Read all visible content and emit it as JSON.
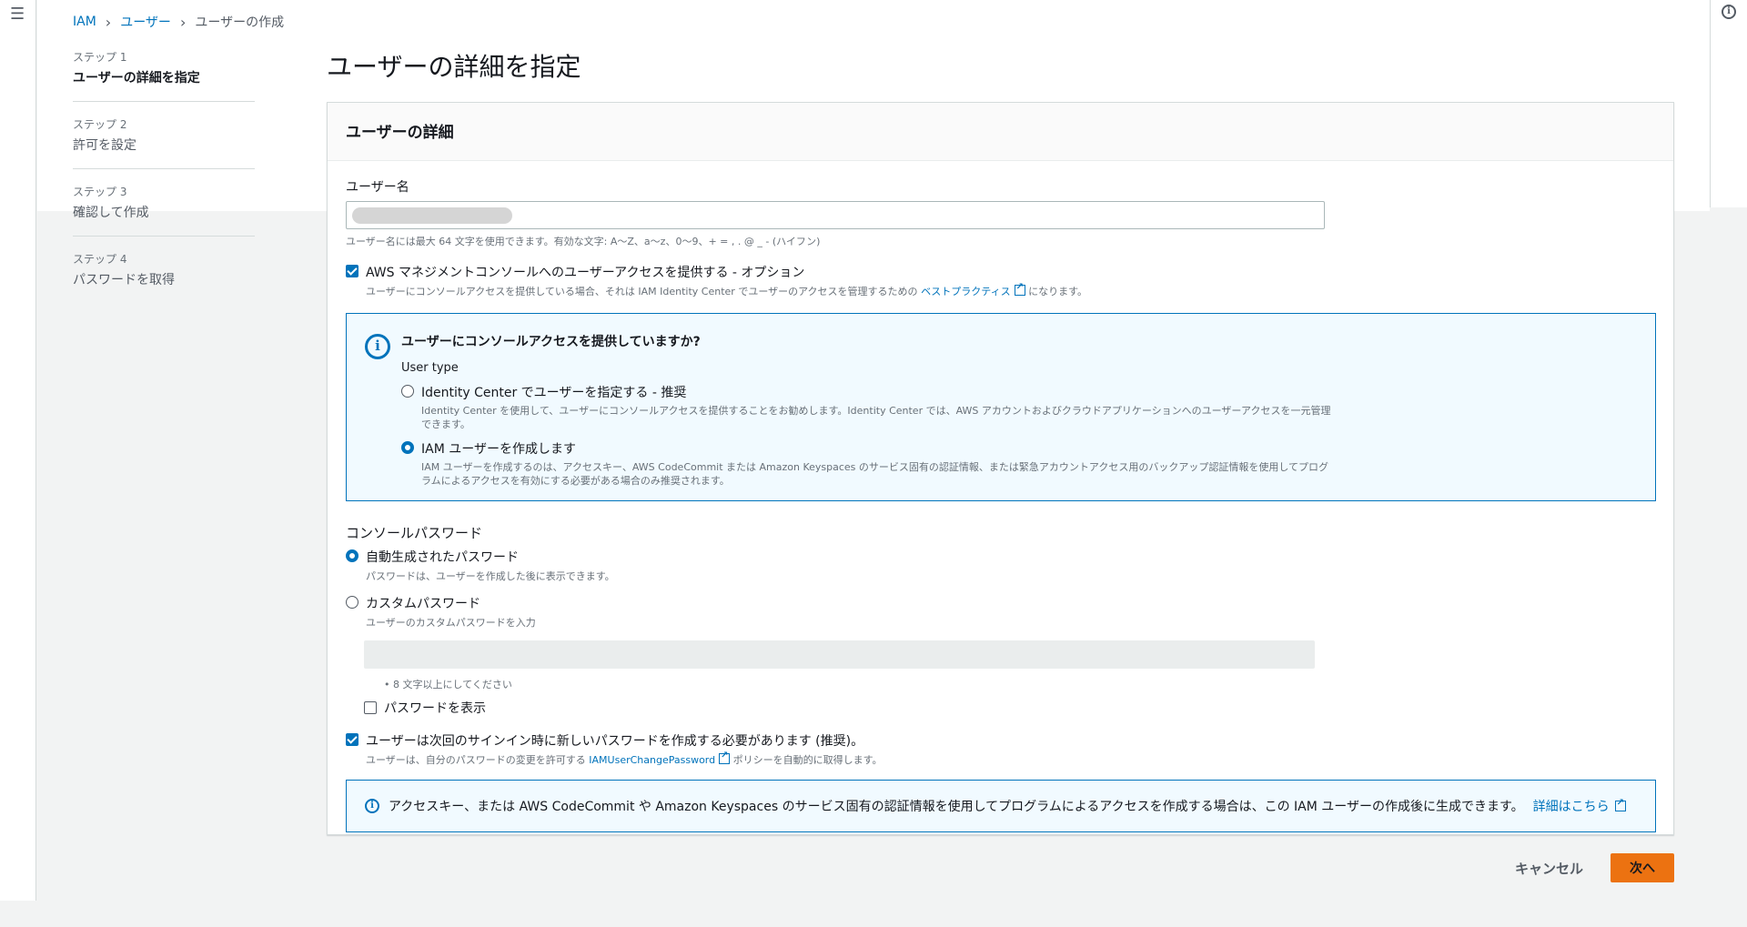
{
  "breadcrumb": {
    "items": [
      "IAM",
      "ユーザー"
    ],
    "current": "ユーザーの作成"
  },
  "steps": [
    {
      "num": "ステップ 1",
      "label": "ユーザーの詳細を指定",
      "active": true
    },
    {
      "num": "ステップ 2",
      "label": "許可を設定",
      "active": false
    },
    {
      "num": "ステップ 3",
      "label": "確認して作成",
      "active": false
    },
    {
      "num": "ステップ 4",
      "label": "パスワードを取得",
      "active": false
    }
  ],
  "page_title": "ユーザーの詳細を指定",
  "container": {
    "header": "ユーザーの詳細",
    "username_label": "ユーザー名",
    "username_hint": "ユーザー名には最大 64 文字を使用できます。有効な文字: A〜Z、a〜z、0〜9、+ = , . @ _ - (ハイフン)",
    "console_access": {
      "label": "AWS マネジメントコンソールへのユーザーアクセスを提供する - オプション",
      "desc_pre": "ユーザーにコンソールアクセスを提供している場合、それは IAM Identity Center でユーザーのアクセスを管理するための",
      "desc_link": "ベストプラクティス",
      "desc_post": "になります。",
      "checked": true
    },
    "info_panel": {
      "title": "ユーザーにコンソールアクセスを提供していますか?",
      "user_type": "User type",
      "option1_label": "Identity Center でユーザーを指定する - 推奨",
      "option1_desc": "Identity Center を使用して、ユーザーにコンソールアクセスを提供することをお勧めします。Identity Center では、AWS アカウントおよびクラウドアプリケーションへのユーザーアクセスを一元管理できます。",
      "option2_label": "IAM ユーザーを作成します",
      "option2_desc": "IAM ユーザーを作成するのは、アクセスキー、AWS CodeCommit または Amazon Keyspaces のサービス固有の認証情報、または緊急アカウントアクセス用のバックアップ認証情報を使用してプログラムによるアクセスを有効にする必要がある場合のみ推奨されます。",
      "selected": "option2"
    },
    "password": {
      "label": "コンソールパスワード",
      "auto_label": "自動生成されたパスワード",
      "auto_desc": "パスワードは、ユーザーを作成した後に表示できます。",
      "custom_label": "カスタムパスワード",
      "custom_desc": "ユーザーのカスタムパスワードを入力",
      "rule": "8 文字以上にしてください",
      "show_password": "パスワードを表示",
      "selected": "auto"
    },
    "reset_required": {
      "label": "ユーザーは次回のサインイン時に新しいパスワードを作成する必要があります (推奨)。",
      "desc_pre": "ユーザーは、自分のパスワードの変更を許可する",
      "desc_link": "IAMUserChangePassword",
      "desc_post": "ポリシーを自動的に取得します。",
      "checked": true
    },
    "bottom_info": {
      "text": "アクセスキー、または AWS CodeCommit や Amazon Keyspaces のサービス固有の認証情報を使用してプログラムによるアクセスを作成する場合は、この IAM ユーザーの作成後に生成できます。",
      "link": "詳細はこちら"
    }
  },
  "footer": {
    "cancel": "キャンセル",
    "next": "次へ"
  },
  "colors": {
    "link": "#0073bb",
    "primary_button": "#ec7211",
    "info_bg": "#f1faff"
  }
}
